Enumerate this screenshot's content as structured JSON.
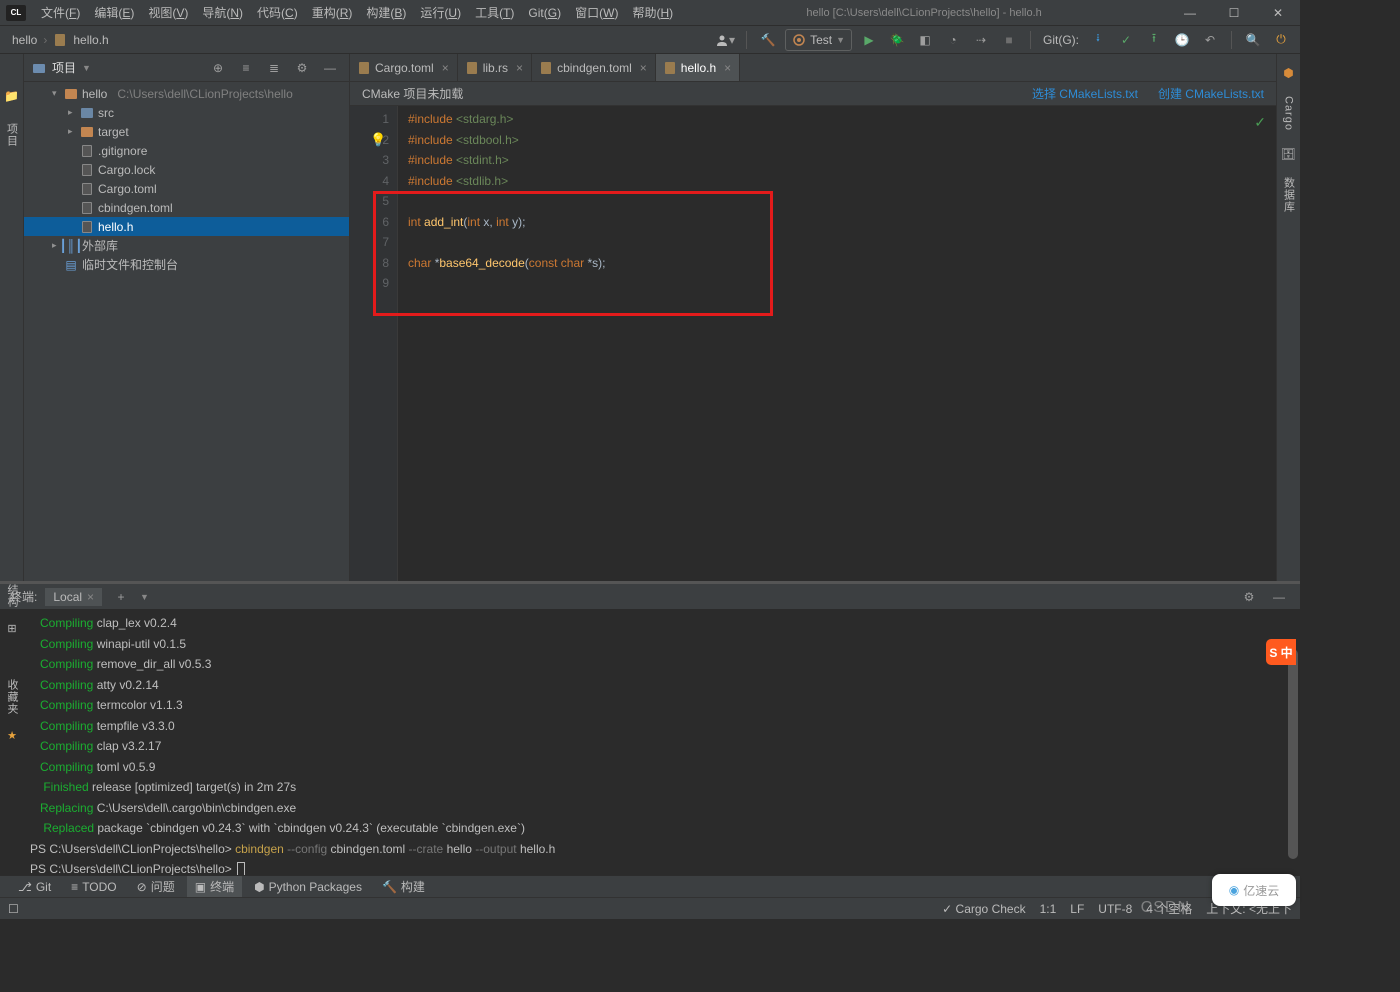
{
  "window": {
    "logo": "CL",
    "title": "hello [C:\\Users\\dell\\CLionProjects\\hello] - hello.h"
  },
  "menubar": [
    {
      "label": "文件",
      "key": "F"
    },
    {
      "label": "编辑",
      "key": "E"
    },
    {
      "label": "视图",
      "key": "V"
    },
    {
      "label": "导航",
      "key": "N"
    },
    {
      "label": "代码",
      "key": "C"
    },
    {
      "label": "重构",
      "key": "R"
    },
    {
      "label": "构建",
      "key": "B"
    },
    {
      "label": "运行",
      "key": "U"
    },
    {
      "label": "工具",
      "key": "T"
    },
    {
      "label": "Git",
      "key": "G"
    },
    {
      "label": "窗口",
      "key": "W"
    },
    {
      "label": "帮助",
      "key": "H"
    }
  ],
  "breadcrumb": [
    "hello",
    "hello.h"
  ],
  "run_config_label": "Test",
  "git_toolbar_label": "Git(G):",
  "left_gutter_label": "项目",
  "right_gutter_labels": [
    "Cargo",
    "数据库"
  ],
  "project": {
    "panel_title": "项目",
    "root": {
      "name": "hello",
      "path": "C:\\Users\\dell\\CLionProjects\\hello"
    },
    "tree": [
      {
        "depth": 1,
        "arrow": "▾",
        "icon": "folder",
        "label": "hello",
        "path": "C:\\Users\\dell\\CLionProjects\\hello"
      },
      {
        "depth": 2,
        "arrow": "▸",
        "icon": "folder-blue",
        "label": "src"
      },
      {
        "depth": 2,
        "arrow": "▸",
        "icon": "folder-orange",
        "label": "target"
      },
      {
        "depth": 2,
        "arrow": "",
        "icon": "file",
        "label": ".gitignore"
      },
      {
        "depth": 2,
        "arrow": "",
        "icon": "file",
        "label": "Cargo.lock"
      },
      {
        "depth": 2,
        "arrow": "",
        "icon": "file",
        "label": "Cargo.toml"
      },
      {
        "depth": 2,
        "arrow": "",
        "icon": "file",
        "label": "cbindgen.toml"
      },
      {
        "depth": 2,
        "arrow": "",
        "icon": "file",
        "label": "hello.h",
        "selected": true
      },
      {
        "depth": 1,
        "arrow": "▸",
        "icon": "lib",
        "label": "外部库"
      },
      {
        "depth": 1,
        "arrow": "",
        "icon": "scratch",
        "label": "临时文件和控制台"
      }
    ]
  },
  "editor": {
    "tabs": [
      {
        "label": "Cargo.toml",
        "active": false
      },
      {
        "label": "lib.rs",
        "active": false
      },
      {
        "label": "cbindgen.toml",
        "active": false
      },
      {
        "label": "hello.h",
        "active": true
      }
    ],
    "warn_bar": {
      "text": "CMake 项目未加载",
      "link1": "选择 CMakeLists.txt",
      "link2": "创建 CMakeLists.txt"
    },
    "lines": [
      "1",
      "2",
      "3",
      "4",
      "5",
      "6",
      "7",
      "8",
      "9"
    ],
    "code": [
      [
        {
          "t": "#include ",
          "c": "kw"
        },
        {
          "t": "<stdarg.h>",
          "c": "str"
        }
      ],
      [
        {
          "t": "#include ",
          "c": "kw"
        },
        {
          "t": "<stdbool.h>",
          "c": "str"
        }
      ],
      [
        {
          "t": "#include ",
          "c": "kw"
        },
        {
          "t": "<stdint.h>",
          "c": "str"
        }
      ],
      [
        {
          "t": "#include ",
          "c": "kw"
        },
        {
          "t": "<stdlib.h>",
          "c": "str"
        }
      ],
      [],
      [
        {
          "t": "int ",
          "c": "typ"
        },
        {
          "t": "add_int",
          "c": "fn"
        },
        {
          "t": "(",
          "c": "op"
        },
        {
          "t": "int ",
          "c": "typ"
        },
        {
          "t": "x",
          "c": "inc"
        },
        {
          "t": ", ",
          "c": "op"
        },
        {
          "t": "int ",
          "c": "typ"
        },
        {
          "t": "y",
          "c": "inc"
        },
        {
          "t": ");",
          "c": "op"
        }
      ],
      [],
      [
        {
          "t": "char ",
          "c": "typ"
        },
        {
          "t": "*",
          "c": "op"
        },
        {
          "t": "base64_decode",
          "c": "fn"
        },
        {
          "t": "(",
          "c": "op"
        },
        {
          "t": "const ",
          "c": "typ"
        },
        {
          "t": "char ",
          "c": "typ"
        },
        {
          "t": "*",
          "c": "op"
        },
        {
          "t": "s",
          "c": "inc"
        },
        {
          "t": ");",
          "c": "op"
        }
      ],
      []
    ]
  },
  "terminal": {
    "title": "终端:",
    "tab": "Local",
    "lines": [
      [
        {
          "t": "   Compiling",
          "c": "t-green"
        },
        {
          "t": " clap_lex v0.2.4",
          "c": "t-white"
        }
      ],
      [
        {
          "t": "   Compiling",
          "c": "t-green"
        },
        {
          "t": " winapi-util v0.1.5",
          "c": "t-white"
        }
      ],
      [
        {
          "t": "   Compiling",
          "c": "t-green"
        },
        {
          "t": " remove_dir_all v0.5.3",
          "c": "t-white"
        }
      ],
      [
        {
          "t": "   Compiling",
          "c": "t-green"
        },
        {
          "t": " atty v0.2.14",
          "c": "t-white"
        }
      ],
      [
        {
          "t": "   Compiling",
          "c": "t-green"
        },
        {
          "t": " termcolor v1.1.3",
          "c": "t-white"
        }
      ],
      [
        {
          "t": "   Compiling",
          "c": "t-green"
        },
        {
          "t": " tempfile v3.3.0",
          "c": "t-white"
        }
      ],
      [
        {
          "t": "   Compiling",
          "c": "t-green"
        },
        {
          "t": " clap v3.2.17",
          "c": "t-white"
        }
      ],
      [
        {
          "t": "   Compiling",
          "c": "t-green"
        },
        {
          "t": " toml v0.5.9",
          "c": "t-white"
        }
      ],
      [
        {
          "t": "    Finished",
          "c": "t-green"
        },
        {
          "t": " release [optimized] target(s) in 2m 27s",
          "c": "t-white"
        }
      ],
      [
        {
          "t": "   Replacing",
          "c": "t-green"
        },
        {
          "t": " C:\\Users\\dell\\.cargo\\bin\\cbindgen.exe",
          "c": "t-white"
        }
      ],
      [
        {
          "t": "    Replaced",
          "c": "t-green"
        },
        {
          "t": " package `cbindgen v0.24.3` with `cbindgen v0.24.3` (executable `cbindgen.exe`)",
          "c": "t-white"
        }
      ],
      [
        {
          "t": "PS C:\\Users\\dell\\CLionProjects\\hello> ",
          "c": "t-path"
        },
        {
          "t": "cbindgen ",
          "c": "t-yellow"
        },
        {
          "t": "--config ",
          "c": "t-gray"
        },
        {
          "t": "cbindgen.toml ",
          "c": "t-white"
        },
        {
          "t": "--crate ",
          "c": "t-gray"
        },
        {
          "t": "hello ",
          "c": "t-white"
        },
        {
          "t": "--output ",
          "c": "t-gray"
        },
        {
          "t": "hello.h",
          "c": "t-white"
        }
      ],
      [
        {
          "t": "PS C:\\Users\\dell\\CLionProjects\\hello> ",
          "c": "t-path"
        }
      ]
    ]
  },
  "bottom_tabs": [
    {
      "icon": "git",
      "label": "Git"
    },
    {
      "icon": "todo",
      "label": "TODO"
    },
    {
      "icon": "problem",
      "label": "问题"
    },
    {
      "icon": "terminal",
      "label": "终端",
      "active": true
    },
    {
      "icon": "python",
      "label": "Python Packages"
    },
    {
      "icon": "build",
      "label": "构建"
    }
  ],
  "statusbar": {
    "cargo_check": "Cargo Check",
    "pos": "1:1",
    "eol": "LF",
    "encoding": "UTF-8",
    "indent": "4 个空格",
    "context_label": "上下文:",
    "context_value": "<无上下",
    "watermark1": "CSDN",
    "watermark2": "亿速云"
  },
  "left_term_icons": [
    "结构",
    "收藏夹"
  ]
}
